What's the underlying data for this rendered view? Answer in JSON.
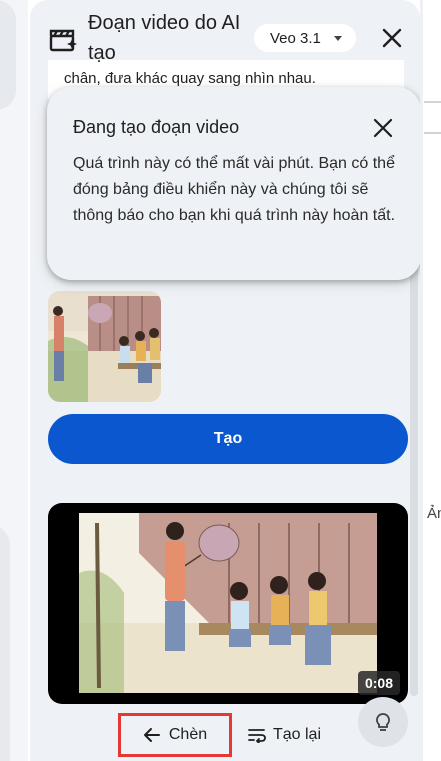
{
  "header": {
    "title": "Đoạn video do AI tạo",
    "model": "Veo 3.1"
  },
  "previous_prompt_fragment": "chân, đưa khác quay sang nhìn nhau.",
  "popup": {
    "title": "Đang tạo đoạn video",
    "body": "Quá trình này có thể mất vài phút. Bạn có thể đóng bảng điều khiển này và chúng tôi sẽ thông báo cho bạn khi quá trình này hoàn tất."
  },
  "create_button": "Tạo",
  "video": {
    "duration": "0:08"
  },
  "actions": {
    "insert": "Chèn",
    "regenerate": "Tạo lại"
  },
  "right_edge_text": "Ản",
  "icons": [
    "clapper-ai-icon",
    "close-icon",
    "chevron-down-icon",
    "arrow-left-icon",
    "wrap-text-icon",
    "lightbulb-icon"
  ],
  "colors": {
    "accent": "#0b57d0",
    "highlight_border": "#e53935",
    "panel_bg": "#eef1f5"
  }
}
